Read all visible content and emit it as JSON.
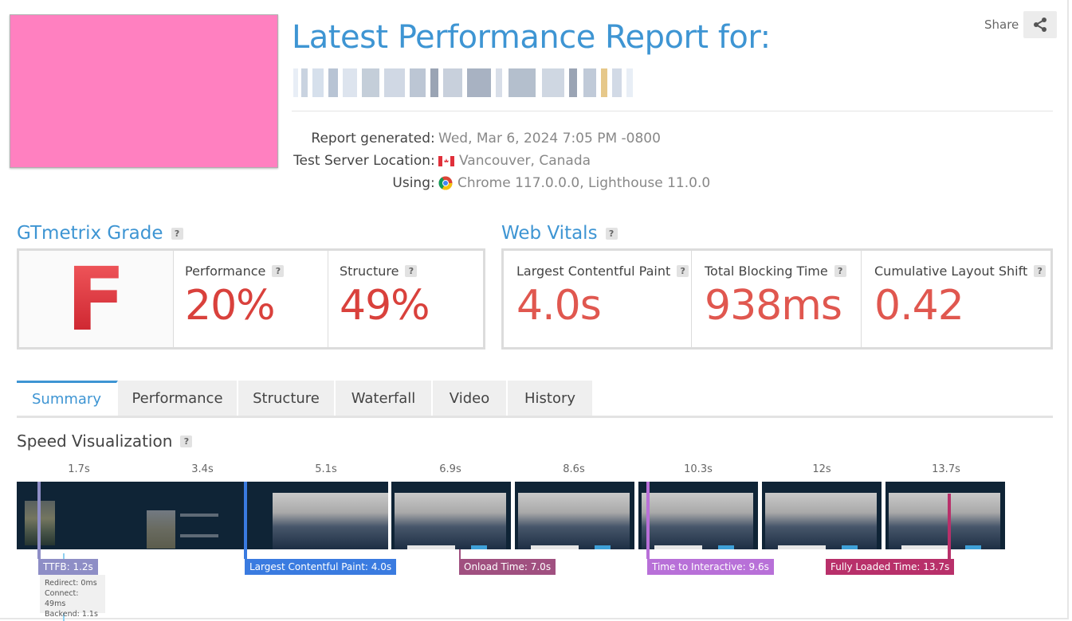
{
  "report": {
    "title": "Latest Performance Report for:",
    "share_label": "Share",
    "meta": [
      {
        "key": "Report generated",
        "value": "Wed, Mar 6, 2024 7:05 PM -0800",
        "icon": ""
      },
      {
        "key": "Test Server Location",
        "value": "Vancouver, Canada",
        "icon": "canada-flag-icon"
      },
      {
        "key": "Using",
        "value": "Chrome 117.0.0.0, Lighthouse 11.0.0",
        "icon": "chrome-icon"
      }
    ]
  },
  "grade": {
    "heading": "GTmetrix Grade",
    "letter": "F",
    "performance_label": "Performance",
    "performance_value": "20%",
    "structure_label": "Structure",
    "structure_value": "49%"
  },
  "vitals": {
    "heading": "Web Vitals",
    "lcp_label": "Largest Contentful Paint",
    "lcp_value": "4.0s",
    "tbt_label": "Total Blocking Time",
    "tbt_value": "938ms",
    "cls_label": "Cumulative Layout Shift",
    "cls_value": "0.42"
  },
  "tabs": [
    "Summary",
    "Performance",
    "Structure",
    "Waterfall",
    "Video",
    "History"
  ],
  "speed": {
    "heading": "Speed Visualization",
    "ticks": [
      "1.7s",
      "3.4s",
      "5.1s",
      "6.9s",
      "8.6s",
      "10.3s",
      "12s",
      "13.7s"
    ],
    "markers": {
      "ttfb": "TTFB: 1.2s",
      "lcp": "Largest Contentful Paint: 4.0s",
      "onload": "Onload Time: 7.0s",
      "tti": "Time to Interactive: 9.6s",
      "fully": "Fully Loaded Time: 13.7s"
    },
    "ttfb_detail": {
      "redirect": "Redirect: 0ms",
      "connect": "Connect: 49ms",
      "backend": "Backend: 1.1s"
    }
  },
  "colors": {
    "accent": "#3e95d3",
    "bad": "#d9413c",
    "ttfb": "#8e8ec6",
    "lcp": "#3a7be0",
    "onload": "#a05080",
    "tti": "#b870d8",
    "fully": "#b8306a"
  }
}
